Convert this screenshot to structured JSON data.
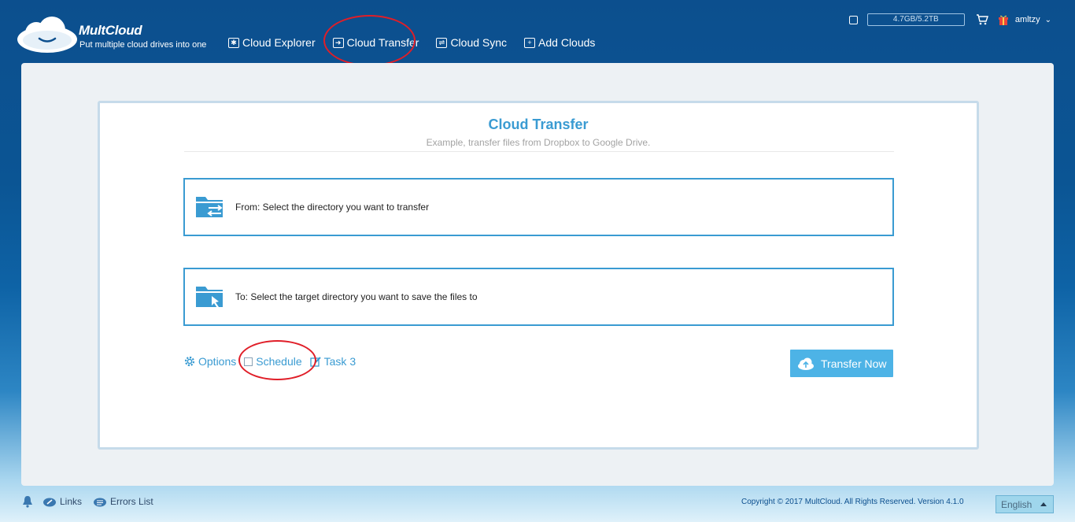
{
  "header": {
    "brand": "MultCloud",
    "tagline": "Put multiple cloud drives into one",
    "nav": [
      {
        "label": "Cloud Explorer",
        "icon": "cloud-explorer-icon"
      },
      {
        "label": "Cloud Transfer",
        "icon": "cloud-transfer-icon"
      },
      {
        "label": "Cloud Sync",
        "icon": "cloud-sync-icon"
      },
      {
        "label": "Add Clouds",
        "icon": "add-clouds-icon"
      }
    ],
    "storage": "4.7GB/5.2TB",
    "username": "amltzy"
  },
  "card": {
    "title": "Cloud Transfer",
    "subtitle": "Example, transfer files from Dropbox to Google Drive.",
    "from_label": "From: Select the directory you want to transfer",
    "to_label": "To: Select the target directory you want to save the files to"
  },
  "options": {
    "options_label": "Options",
    "schedule_label": "Schedule",
    "task_label": "Task 3",
    "transfer_button": "Transfer Now"
  },
  "footer": {
    "links": "Links",
    "errors": "Errors List",
    "copyright": "Copyright © 2017 MultCloud. All Rights Reserved. Version 4.1.0",
    "language": "English"
  },
  "colors": {
    "accent": "#3a9bd2",
    "button": "#4db3e6",
    "highlight": "#e01e28"
  }
}
